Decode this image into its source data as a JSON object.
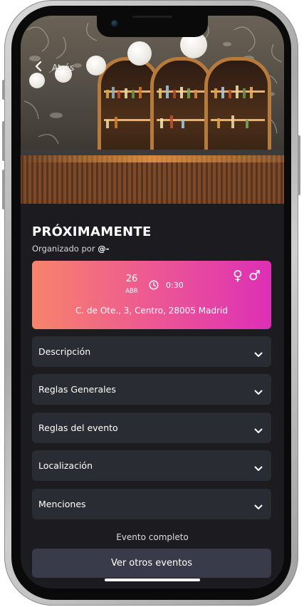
{
  "header": {
    "back_label": "Atrás"
  },
  "event": {
    "title": "PRÓXIMAMENTE",
    "organizer_prefix": "Organizado por",
    "organizer_handle": "@-",
    "date_day": "26",
    "date_month": "ABR",
    "time": "0:30",
    "female_symbol": "♀",
    "male_symbol": "♂",
    "address": "C. de Ote., 3, Centro, 28005 Madrid",
    "card_gradient": [
      "#f7846b",
      "#ee5c8f",
      "#dd2fb6"
    ]
  },
  "sections": [
    {
      "label": "Descripción"
    },
    {
      "label": "Reglas Generales"
    },
    {
      "label": "Reglas del evento"
    },
    {
      "label": "Localización"
    },
    {
      "label": "Menciones"
    }
  ],
  "footer": {
    "status_text": "Evento completo",
    "cta_label": "Ver otros eventos"
  },
  "icons": {
    "back": "chevron-left-icon",
    "clock": "clock-icon",
    "expand": "chevron-down-icon"
  },
  "colors": {
    "background": "#1c1c20",
    "panel": "#2a2c33",
    "cta": "#3a3b4a"
  }
}
